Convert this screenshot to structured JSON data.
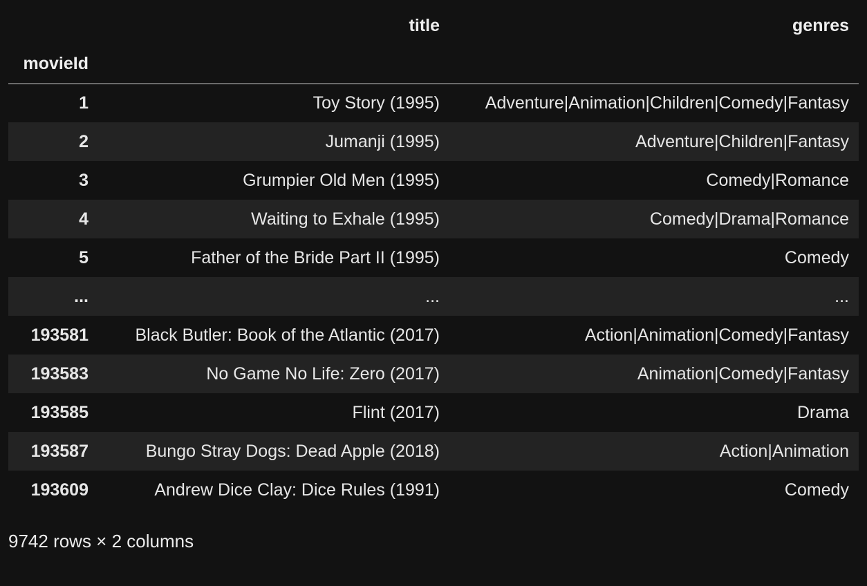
{
  "table": {
    "columns": [
      "title",
      "genres"
    ],
    "index_name": "movieId",
    "rows": [
      {
        "index": "1",
        "title": "Toy Story (1995)",
        "genres": "Adventure|Animation|Children|Comedy|Fantasy"
      },
      {
        "index": "2",
        "title": "Jumanji (1995)",
        "genres": "Adventure|Children|Fantasy"
      },
      {
        "index": "3",
        "title": "Grumpier Old Men (1995)",
        "genres": "Comedy|Romance"
      },
      {
        "index": "4",
        "title": "Waiting to Exhale (1995)",
        "genres": "Comedy|Drama|Romance"
      },
      {
        "index": "5",
        "title": "Father of the Bride Part II (1995)",
        "genres": "Comedy"
      },
      {
        "index": "...",
        "title": "...",
        "genres": "..."
      },
      {
        "index": "193581",
        "title": "Black Butler: Book of the Atlantic (2017)",
        "genres": "Action|Animation|Comedy|Fantasy"
      },
      {
        "index": "193583",
        "title": "No Game No Life: Zero (2017)",
        "genres": "Animation|Comedy|Fantasy"
      },
      {
        "index": "193585",
        "title": "Flint (2017)",
        "genres": "Drama"
      },
      {
        "index": "193587",
        "title": "Bungo Stray Dogs: Dead Apple (2018)",
        "genres": "Action|Animation"
      },
      {
        "index": "193609",
        "title": "Andrew Dice Clay: Dice Rules (1991)",
        "genres": "Comedy"
      }
    ]
  },
  "footer": "9742 rows × 2 columns"
}
